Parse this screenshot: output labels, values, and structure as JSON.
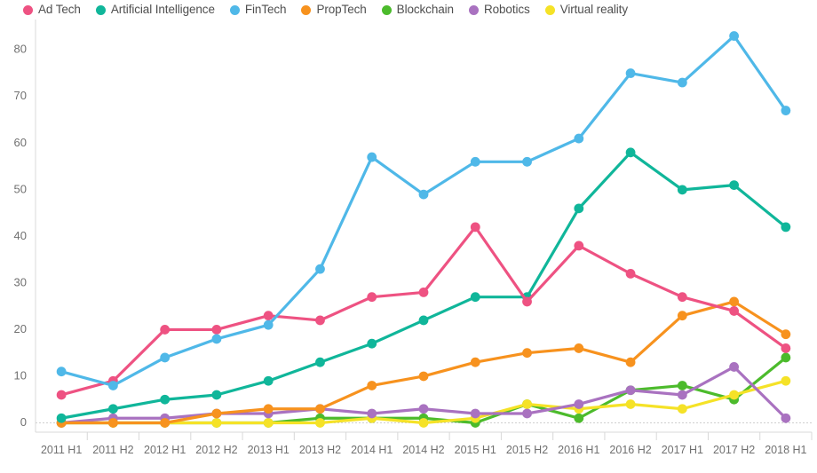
{
  "chart_data": {
    "type": "line",
    "title": "",
    "subtitle": "",
    "xlabel": "",
    "ylabel": "",
    "ylim": [
      -2,
      85
    ],
    "yticks": [
      0,
      10,
      20,
      30,
      40,
      50,
      60,
      70,
      80
    ],
    "grid": false,
    "legend_position": "top-left",
    "categories": [
      "2011 H1",
      "2011 H2",
      "2012 H1",
      "2012 H2",
      "2013 H1",
      "2013 H2",
      "2014 H1",
      "2014 H2",
      "2015 H1",
      "2015 H2",
      "2016 H1",
      "2016 H2",
      "2017 H1",
      "2017 H2",
      "2018 H1"
    ],
    "series": [
      {
        "name": "Ad Tech",
        "color": "#EE5282",
        "values": [
          6,
          9,
          20,
          20,
          23,
          22,
          27,
          28,
          42,
          26,
          38,
          32,
          27,
          24,
          16
        ]
      },
      {
        "name": "Artificial Intelligence",
        "color": "#10B69A",
        "values": [
          1,
          3,
          5,
          6,
          9,
          13,
          17,
          22,
          27,
          27,
          46,
          58,
          50,
          51,
          42
        ]
      },
      {
        "name": "FinTech",
        "color": "#4FB8E8",
        "values": [
          11,
          8,
          14,
          18,
          21,
          33,
          57,
          49,
          56,
          56,
          61,
          75,
          73,
          83,
          67
        ]
      },
      {
        "name": "PropTech",
        "color": "#F7921E",
        "values": [
          0,
          0,
          0,
          2,
          3,
          3,
          8,
          10,
          13,
          15,
          16,
          13,
          23,
          26,
          19
        ]
      },
      {
        "name": "Blockchain",
        "color": "#4CBB2C",
        "values": [
          0,
          0,
          0,
          0,
          0,
          1,
          1,
          1,
          0,
          4,
          1,
          7,
          8,
          5,
          14
        ]
      },
      {
        "name": "Robotics",
        "color": "#A972C0",
        "values": [
          0,
          1,
          1,
          2,
          2,
          3,
          2,
          3,
          2,
          2,
          4,
          7,
          6,
          12,
          1
        ]
      },
      {
        "name": "Virtual reality",
        "color": "#F5E227",
        "values": [
          0,
          0,
          0,
          0,
          0,
          0,
          1,
          0,
          1,
          4,
          3,
          4,
          3,
          6,
          9
        ]
      }
    ]
  },
  "legend": {
    "items": [
      {
        "label": "Ad Tech",
        "color": "#EE5282"
      },
      {
        "label": "Artificial Intelligence",
        "color": "#10B69A"
      },
      {
        "label": "FinTech",
        "color": "#4FB8E8"
      },
      {
        "label": "PropTech",
        "color": "#F7921E"
      },
      {
        "label": "Blockchain",
        "color": "#4CBB2C"
      },
      {
        "label": "Robotics",
        "color": "#A972C0"
      },
      {
        "label": "Virtual reality",
        "color": "#F5E227"
      }
    ]
  }
}
